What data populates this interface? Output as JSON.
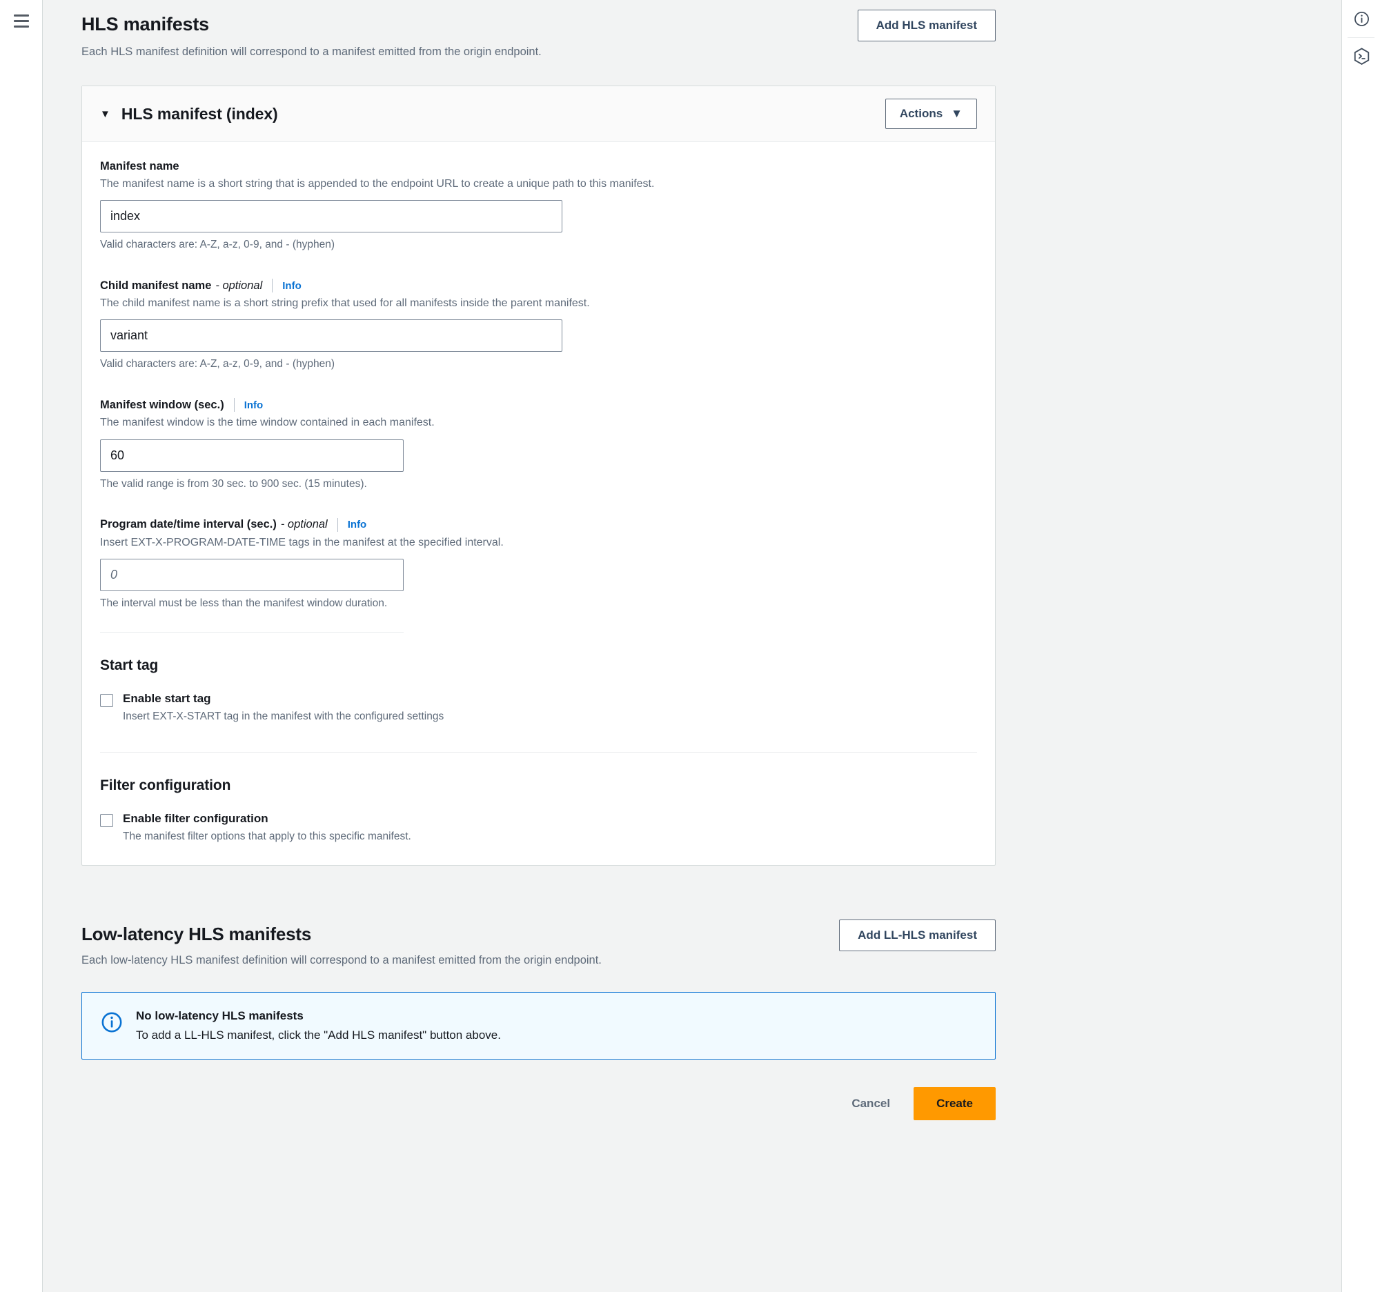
{
  "colors": {
    "accent_link": "#0972d3",
    "primary_button": "#ff9900",
    "alert_border": "#0972d3",
    "alert_background": "#f1faff",
    "page_background": "#f2f3f3"
  },
  "left_rail": {
    "menu_icon": "hamburger-menu-icon"
  },
  "right_rail": {
    "items": [
      {
        "icon": "info-circle-icon"
      },
      {
        "icon": "cloudshell-hexagon-icon"
      }
    ]
  },
  "hls_section": {
    "title": "HLS manifests",
    "description": "Each HLS manifest definition will correspond to a manifest emitted from the origin endpoint.",
    "add_button": "Add HLS manifest"
  },
  "manifest_card": {
    "title": "HLS manifest (index)",
    "expand_caret": "▼",
    "actions_button": "Actions",
    "actions_caret": "▼",
    "fields": {
      "manifest_name": {
        "label": "Manifest name",
        "description": "The manifest name is a short string that is appended to the endpoint URL to create a unique path to this manifest.",
        "value": "index",
        "constraint": "Valid characters are: A-Z, a-z, 0-9, and - (hyphen)"
      },
      "child_manifest_name": {
        "label": "Child manifest name",
        "optional_suffix": "- optional",
        "info": "Info",
        "description": "The child manifest name is a short string prefix that used for all manifests inside the parent manifest.",
        "value": "variant",
        "constraint": "Valid characters are: A-Z, a-z, 0-9, and - (hyphen)"
      },
      "manifest_window": {
        "label": "Manifest window (sec.)",
        "info": "Info",
        "description": "The manifest window is the time window contained in each manifest.",
        "value": "60",
        "constraint": "The valid range is from 30 sec. to 900 sec. (15 minutes)."
      },
      "program_date_time_interval": {
        "label": "Program date/time interval (sec.)",
        "optional_suffix": "- optional",
        "info": "Info",
        "description": "Insert EXT-X-PROGRAM-DATE-TIME tags in the manifest at the specified interval.",
        "value": "",
        "placeholder": "0",
        "constraint": "The interval must be less than the manifest window duration."
      }
    },
    "start_tag": {
      "title": "Start tag",
      "checkbox_label": "Enable start tag",
      "checkbox_checked": false,
      "checkbox_description": "Insert EXT-X-START tag in the manifest with the configured settings"
    },
    "filter_configuration": {
      "title": "Filter configuration",
      "checkbox_label": "Enable filter configuration",
      "checkbox_checked": false,
      "checkbox_description": "The manifest filter options that apply to this specific manifest."
    }
  },
  "ll_section": {
    "title": "Low-latency HLS manifests",
    "description": "Each low-latency HLS manifest definition will correspond to a manifest emitted from the origin endpoint.",
    "add_button": "Add LL-HLS manifest",
    "alert": {
      "icon": "info-circle-icon",
      "title": "No low-latency HLS manifests",
      "text": "To add a LL-HLS manifest, click the \"Add HLS manifest\" button above."
    }
  },
  "footer": {
    "cancel": "Cancel",
    "create": "Create"
  }
}
